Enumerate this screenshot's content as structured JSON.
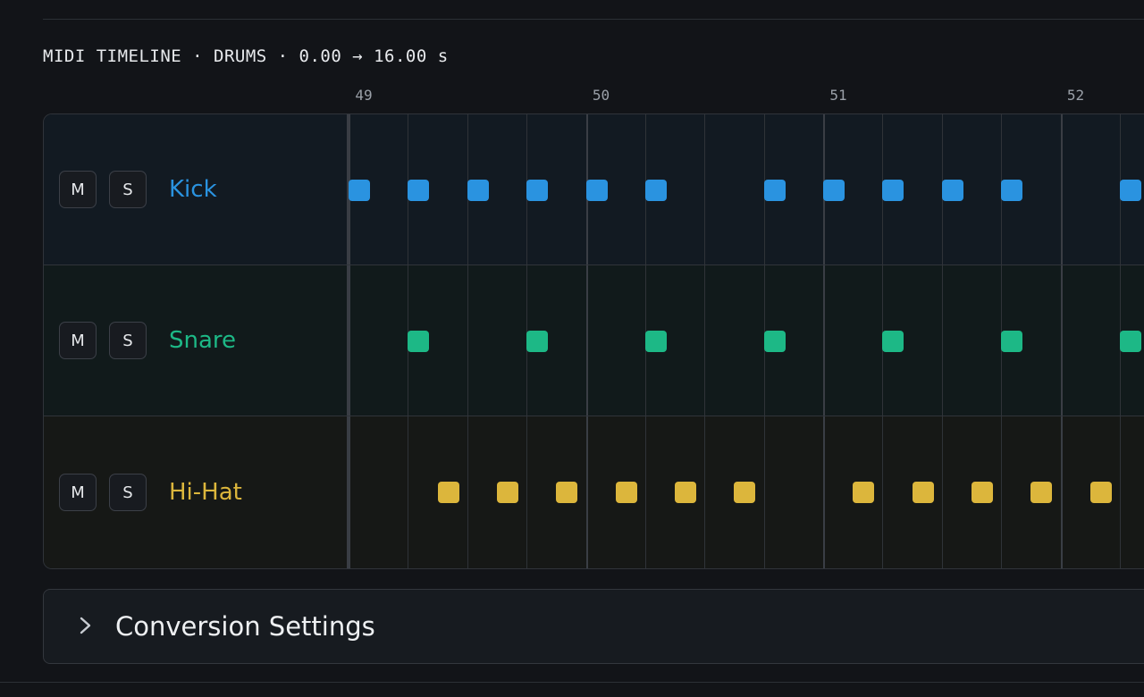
{
  "timeline": {
    "title": "MIDI TIMELINE · DRUMS · 0.00 → 16.00 s",
    "ruler_labels": [
      "49",
      "50",
      "51",
      "52"
    ],
    "tracks": [
      {
        "name": "Kick",
        "color": "#2a93e0",
        "bg": "#121a22",
        "mute_label": "M",
        "solo_label": "S",
        "notes": [
          0,
          0.25,
          0.5,
          0.75,
          1,
          1.25,
          1.75,
          2,
          2.25,
          2.5,
          2.75,
          3.25
        ]
      },
      {
        "name": "Snare",
        "color": "#1db886",
        "bg": "#111a1b",
        "mute_label": "M",
        "solo_label": "S",
        "notes": [
          0.25,
          0.75,
          1.25,
          1.75,
          2.25,
          2.75,
          3.25
        ]
      },
      {
        "name": "Hi-Hat",
        "color": "#dcb63c",
        "bg": "#161816",
        "mute_label": "M",
        "solo_label": "S",
        "notes": [
          0.375,
          0.625,
          0.875,
          1.125,
          1.375,
          1.625,
          2.125,
          2.375,
          2.625,
          2.875,
          3.125
        ]
      }
    ]
  },
  "settings": {
    "label": "Conversion Settings",
    "expanded": false
  }
}
